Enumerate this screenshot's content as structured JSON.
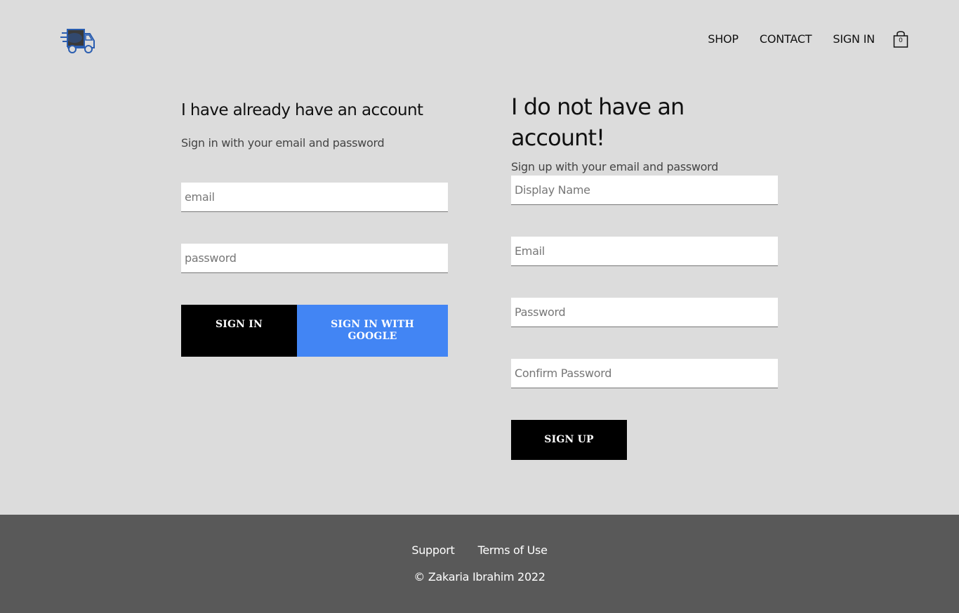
{
  "header": {
    "logo_icon": "delivery-van-icon",
    "nav": [
      {
        "label": "SHOP"
      },
      {
        "label": "CONTACT"
      },
      {
        "label": "SIGN IN"
      }
    ],
    "cart": {
      "icon": "shopping-bag-icon",
      "count": "0"
    }
  },
  "sign_in": {
    "title": "I have already have an account",
    "subtitle": "Sign in with your email and password",
    "email_placeholder": "email",
    "password_placeholder": "password",
    "sign_in_label": "SIGN IN",
    "google_label": "SIGN IN WITH GOOGLE",
    "google_color": "#4285f4"
  },
  "sign_up": {
    "title": "I do not have an account!",
    "subtitle": "Sign up with your email and password",
    "display_name_placeholder": "Display Name",
    "email_placeholder": "Email",
    "password_placeholder": "Password",
    "confirm_password_placeholder": "Confirm Password",
    "sign_up_label": "SIGN UP"
  },
  "footer": {
    "links": [
      {
        "label": "Support"
      },
      {
        "label": "Terms of Use"
      }
    ],
    "copyright": "© Zakaria Ibrahim 2022"
  }
}
